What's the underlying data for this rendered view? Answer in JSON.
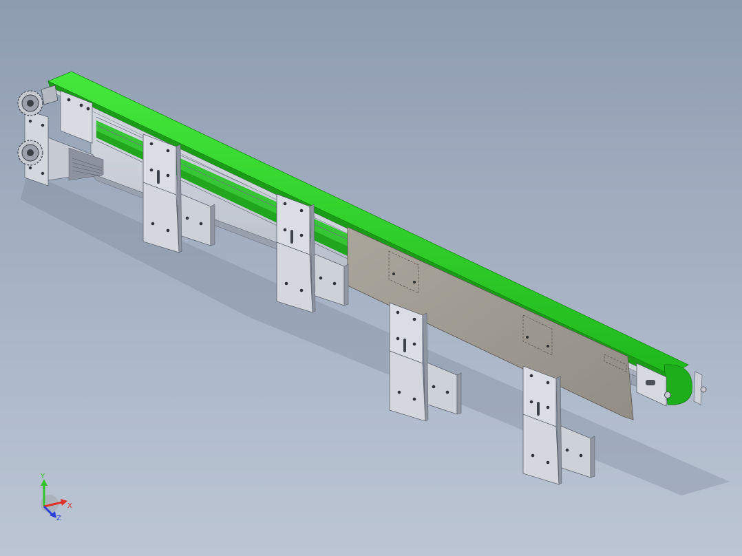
{
  "viewport": {
    "background_top": "#8e9cb0",
    "background_bottom": "#bcc6d4"
  },
  "model": {
    "belt_color": "#2fd62a",
    "belt_dark": "#1a9c17",
    "frame_color": "#b9bfcb",
    "guard_color": "#9e9a92"
  },
  "triad": {
    "x_label": "X",
    "y_label": "Y",
    "z_label": "Z",
    "x_color": "#e0302a",
    "y_color": "#2fc52a",
    "z_color": "#2a3fd8"
  }
}
